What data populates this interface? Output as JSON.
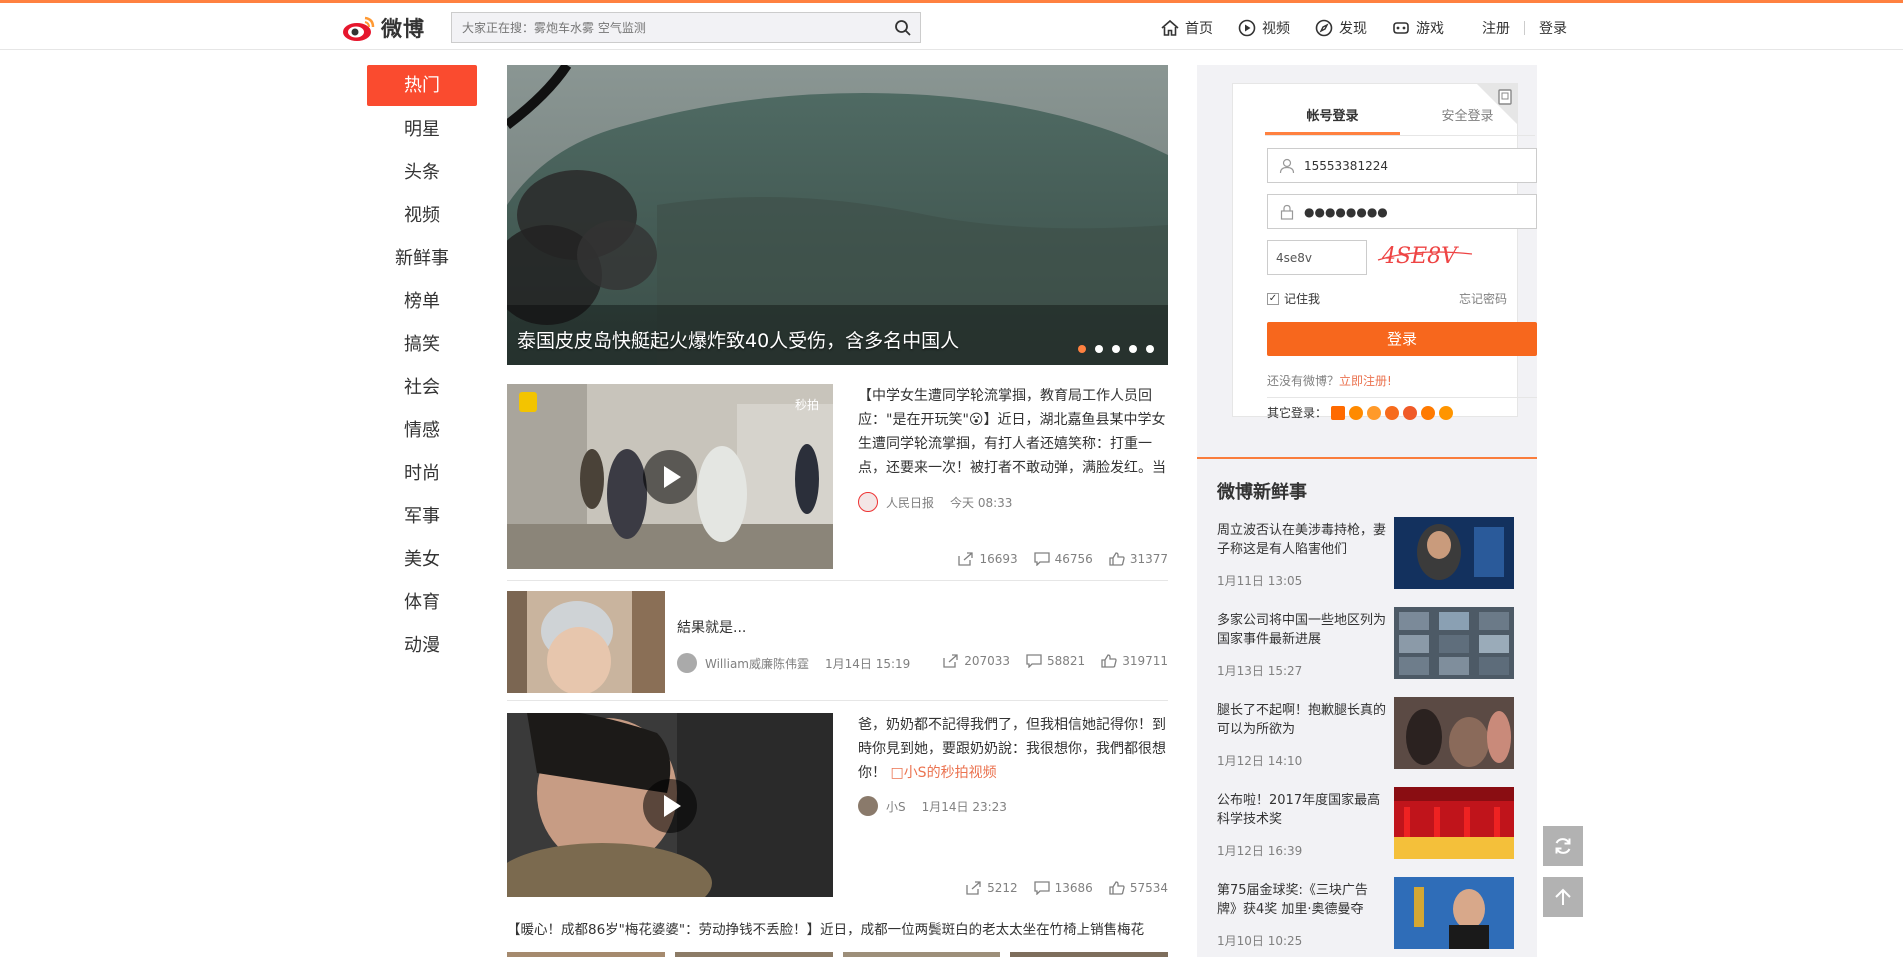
{
  "app": {
    "logo_text": "微博",
    "brand_color": "#ff8140"
  },
  "search": {
    "placeholder": "大家正在搜：雾炮车水雾 空气监测"
  },
  "nav": {
    "home": "首页",
    "video": "视频",
    "discover": "发现",
    "game": "游戏",
    "register": "注册",
    "login": "登录"
  },
  "leftnav": {
    "items": [
      "热门",
      "明星",
      "头条",
      "视频",
      "新鲜事",
      "榜单",
      "搞笑",
      "社会",
      "情感",
      "时尚",
      "军事",
      "美女",
      "体育",
      "动漫"
    ],
    "active_index": 0
  },
  "hero": {
    "caption": "泰国皮皮岛快艇起火爆炸致40人受伤，含多名中国人",
    "slide_count": 5,
    "active_slide": 0
  },
  "feed": [
    {
      "text_main": "【中学女生遭同学轮流掌掴，教育局工作人员回应：\"是在开玩笑\"😮】近日，湖北嘉鱼县某中学女生遭同学轮流掌掴，有打人者还嬉笑称：打重一点，还要来一次！被打者不敢动弹，满脸发红。当",
      "author": "人民日报",
      "time": "今天 08:33",
      "reposts": "16693",
      "comments": "46756",
      "likes": "31377",
      "badge": "秒拍"
    },
    {
      "text_main": "結果就是...",
      "author": "William威廉陈伟霆",
      "time": "1月14日 15:19",
      "reposts": "207033",
      "comments": "58821",
      "likes": "319711"
    },
    {
      "text_main": "爸，奶奶都不記得我們了，但我相信她記得你！到時你見到她，要跟奶奶說：我很想你，我們都很想你！",
      "link": "小S的秒拍视频",
      "author": "小S",
      "time": "1月14日 23:23",
      "reposts": "5212",
      "comments": "13686",
      "likes": "57534"
    },
    {
      "text_main": "【暖心！成都86岁\"梅花婆婆\"：劳动挣钱不丢脸！】近日，成都一位两鬓斑白的老太太坐在竹椅上销售梅花"
    }
  ],
  "login": {
    "tab_account": "帐号登录",
    "tab_secure": "安全登录",
    "username": "15553381224",
    "password_mask": "●●●●●●●●",
    "vcode_value": "4se8v",
    "captcha_text": "4SE8V",
    "remember_label": "记住我",
    "forgot_label": "忘记密码",
    "submit_label": "登录",
    "no_account_text": "还没有微博？",
    "register_link": "立即注册!",
    "other_login_label": "其它登录："
  },
  "fresh": {
    "title": "微博新鲜事",
    "items": [
      {
        "title": "周立波否认在美涉毒持枪，妻子称这是有人陷害他们",
        "date": "1月11日 13:05"
      },
      {
        "title": "多家公司将中国一些地区列为国家事件最新进展",
        "date": "1月13日 15:27"
      },
      {
        "title": "腿长了不起啊！抱歉腿长真的可以为所欲为",
        "date": "1月12日 14:10"
      },
      {
        "title": "公布啦！2017年度国家最高科学技术奖",
        "date": "1月12日 16:39"
      },
      {
        "title": "第75届金球奖:《三块广告牌》获4奖 加里·奥德曼夺",
        "date": "1月10日 10:25"
      }
    ]
  },
  "icons": {
    "search": "search-icon",
    "home": "home-icon",
    "video": "video-icon",
    "discover": "compass-icon",
    "game": "game-icon",
    "refresh": "refresh-icon",
    "top": "arrow-up-icon"
  }
}
